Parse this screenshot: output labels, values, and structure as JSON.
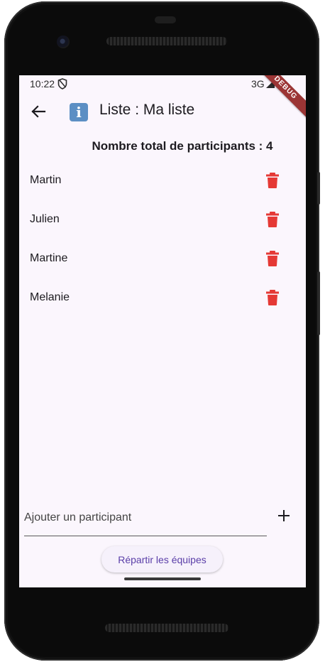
{
  "status_bar": {
    "time": "10:22",
    "network": "3G"
  },
  "debug_banner": "DEBUG",
  "app_bar": {
    "title": "Liste : Ma liste",
    "info_icon_char": "i"
  },
  "summary": {
    "total_label": "Nombre total de participants : 4"
  },
  "participants": [
    {
      "name": "Martin"
    },
    {
      "name": "Julien"
    },
    {
      "name": "Martine"
    },
    {
      "name": "Melanie"
    }
  ],
  "add_participant": {
    "placeholder": "Ajouter un participant",
    "value": ""
  },
  "actions": {
    "split_label": "Répartir les équipes"
  },
  "colors": {
    "delete": "#e53935",
    "accent": "#5a3ea8",
    "background": "#fbf6fd",
    "debug": "#9b3535"
  },
  "icons": [
    "arrow-back-icon",
    "info-icon",
    "delete-icon",
    "add-icon",
    "shield-icon",
    "signal-icon",
    "battery-icon"
  ]
}
